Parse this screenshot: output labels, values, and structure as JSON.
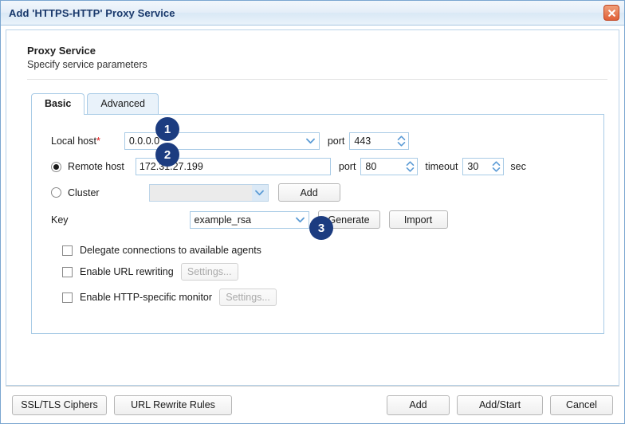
{
  "window": {
    "title": "Add 'HTTPS-HTTP' Proxy Service",
    "close_icon": "close-icon"
  },
  "header": {
    "title": "Proxy Service",
    "subtitle": "Specify service parameters"
  },
  "tabs": [
    {
      "label": "Basic",
      "active": true
    },
    {
      "label": "Advanced",
      "active": false
    }
  ],
  "form": {
    "local_host": {
      "label": "Local host",
      "required_mark": "*",
      "value": "0.0.0.0",
      "port_label": "port",
      "port_value": "443"
    },
    "remote_host": {
      "label": "Remote host",
      "selected": true,
      "value": "172.31.27.199",
      "port_label": "port",
      "port_value": "80",
      "timeout_label": "timeout",
      "timeout_value": "30",
      "timeout_unit": "sec"
    },
    "cluster": {
      "label": "Cluster",
      "selected": false,
      "value": "",
      "add_button": "Add"
    },
    "key": {
      "label": "Key",
      "value": "example_rsa",
      "generate_button": "Generate",
      "import_button": "Import"
    },
    "checkboxes": [
      {
        "label": "Delegate connections to available agents",
        "checked": false
      },
      {
        "label": "Enable URL rewriting",
        "checked": false,
        "settings_button": "Settings..."
      },
      {
        "label": "Enable HTTP-specific monitor",
        "checked": false,
        "settings_button": "Settings..."
      }
    ]
  },
  "callouts": [
    {
      "number": "1"
    },
    {
      "number": "2"
    },
    {
      "number": "3"
    }
  ],
  "footer": {
    "left": [
      {
        "label": "SSL/TLS Ciphers"
      },
      {
        "label": "URL Rewrite Rules"
      }
    ],
    "right": [
      {
        "label": "Add"
      },
      {
        "label": "Add/Start"
      },
      {
        "label": "Cancel"
      }
    ]
  },
  "colors": {
    "badge": "#1c3c80",
    "title_text": "#18386b",
    "close_button": "#e06038",
    "required_asterisk": "#dd1111",
    "panel_border": "#a9cbe6"
  }
}
